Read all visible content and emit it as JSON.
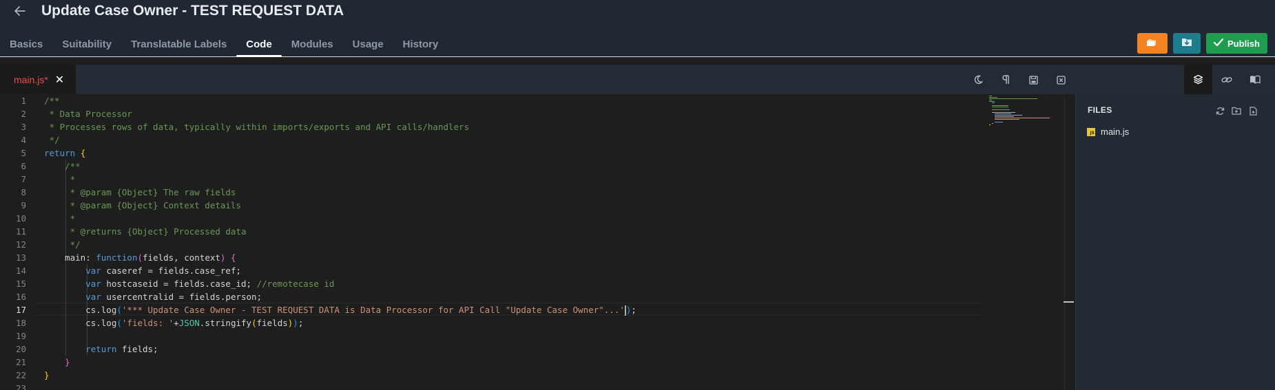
{
  "header": {
    "title": "Update Case Owner - TEST REQUEST DATA",
    "publish_label": "Publish",
    "tabs": [
      {
        "label": "Basics"
      },
      {
        "label": "Suitability"
      },
      {
        "label": "Translatable Labels"
      },
      {
        "label": "Code",
        "active": true
      },
      {
        "label": "Modules"
      },
      {
        "label": "Usage"
      },
      {
        "label": "History"
      }
    ]
  },
  "editor": {
    "tab_name": "main.js*",
    "line_numbers": [
      "1",
      "2",
      "3",
      "4",
      "5",
      "6",
      "7",
      "8",
      "9",
      "10",
      "11",
      "12",
      "13",
      "14",
      "15",
      "16",
      "17",
      "18",
      "19",
      "20",
      "21",
      "22",
      "23"
    ],
    "active_line": 17
  },
  "files_panel": {
    "title": "FILES",
    "files": [
      {
        "name": "main.js"
      }
    ]
  },
  "colors": {
    "orange": "#f58220",
    "teal": "#1e7d8c",
    "green": "#1f9d4f",
    "comment": "#6a9955",
    "keyword": "#569cd6",
    "string": "#ce9178"
  }
}
